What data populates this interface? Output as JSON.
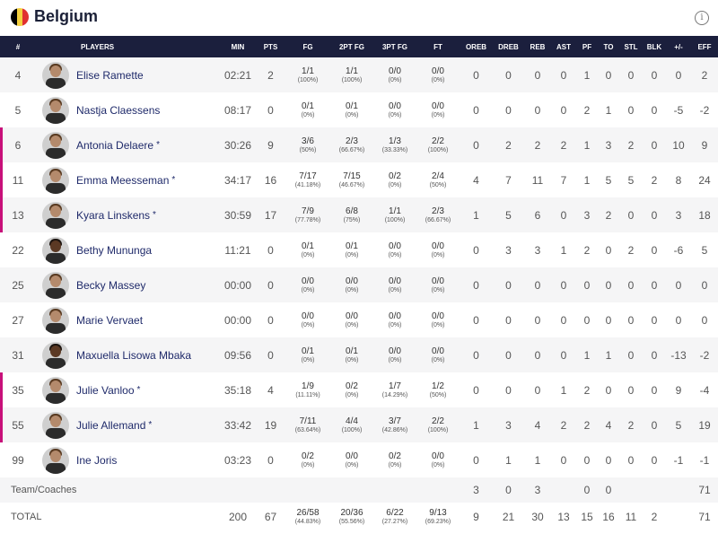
{
  "team": {
    "name": "Belgium",
    "flag_colors": [
      "#000000",
      "#f4d03f",
      "#e03030"
    ]
  },
  "info_icon": "info-icon",
  "columns": [
    "#",
    "PLAYERS",
    "MIN",
    "PTS",
    "FG",
    "2PT FG",
    "3PT FG",
    "FT",
    "OREB",
    "DREB",
    "REB",
    "AST",
    "PF",
    "TO",
    "STL",
    "BLK",
    "+/-",
    "EFF"
  ],
  "players": [
    {
      "no": "4",
      "name": "Elise Ramette",
      "starter": false,
      "min": "02:21",
      "pts": "2",
      "fg": "1/1",
      "fg_pct": "(100%)",
      "fg2": "1/1",
      "fg2_pct": "(100%)",
      "fg3": "0/0",
      "fg3_pct": "(0%)",
      "ft": "0/0",
      "ft_pct": "(0%)",
      "oreb": "0",
      "dreb": "0",
      "reb": "0",
      "ast": "0",
      "pf": "1",
      "to": "0",
      "stl": "0",
      "blk": "0",
      "pm": "0",
      "eff": "2"
    },
    {
      "no": "5",
      "name": "Nastja Claessens",
      "starter": false,
      "min": "08:17",
      "pts": "0",
      "fg": "0/1",
      "fg_pct": "(0%)",
      "fg2": "0/1",
      "fg2_pct": "(0%)",
      "fg3": "0/0",
      "fg3_pct": "(0%)",
      "ft": "0/0",
      "ft_pct": "(0%)",
      "oreb": "0",
      "dreb": "0",
      "reb": "0",
      "ast": "0",
      "pf": "2",
      "to": "1",
      "stl": "0",
      "blk": "0",
      "pm": "-5",
      "eff": "-2"
    },
    {
      "no": "6",
      "name": "Antonia Delaere",
      "starter": true,
      "min": "30:26",
      "pts": "9",
      "fg": "3/6",
      "fg_pct": "(50%)",
      "fg2": "2/3",
      "fg2_pct": "(66.67%)",
      "fg3": "1/3",
      "fg3_pct": "(33.33%)",
      "ft": "2/2",
      "ft_pct": "(100%)",
      "oreb": "0",
      "dreb": "2",
      "reb": "2",
      "ast": "2",
      "pf": "1",
      "to": "3",
      "stl": "2",
      "blk": "0",
      "pm": "10",
      "eff": "9"
    },
    {
      "no": "11",
      "name": "Emma Meesseman",
      "starter": true,
      "min": "34:17",
      "pts": "16",
      "fg": "7/17",
      "fg_pct": "(41.18%)",
      "fg2": "7/15",
      "fg2_pct": "(46.67%)",
      "fg3": "0/2",
      "fg3_pct": "(0%)",
      "ft": "2/4",
      "ft_pct": "(50%)",
      "oreb": "4",
      "dreb": "7",
      "reb": "11",
      "ast": "7",
      "pf": "1",
      "to": "5",
      "stl": "5",
      "blk": "2",
      "pm": "8",
      "eff": "24"
    },
    {
      "no": "13",
      "name": "Kyara Linskens",
      "starter": true,
      "min": "30:59",
      "pts": "17",
      "fg": "7/9",
      "fg_pct": "(77.78%)",
      "fg2": "6/8",
      "fg2_pct": "(75%)",
      "fg3": "1/1",
      "fg3_pct": "(100%)",
      "ft": "2/3",
      "ft_pct": "(66.67%)",
      "oreb": "1",
      "dreb": "5",
      "reb": "6",
      "ast": "0",
      "pf": "3",
      "to": "2",
      "stl": "0",
      "blk": "0",
      "pm": "3",
      "eff": "18"
    },
    {
      "no": "22",
      "name": "Bethy Mununga",
      "starter": false,
      "dark": true,
      "min": "11:21",
      "pts": "0",
      "fg": "0/1",
      "fg_pct": "(0%)",
      "fg2": "0/1",
      "fg2_pct": "(0%)",
      "fg3": "0/0",
      "fg3_pct": "(0%)",
      "ft": "0/0",
      "ft_pct": "(0%)",
      "oreb": "0",
      "dreb": "3",
      "reb": "3",
      "ast": "1",
      "pf": "2",
      "to": "0",
      "stl": "2",
      "blk": "0",
      "pm": "-6",
      "eff": "5"
    },
    {
      "no": "25",
      "name": "Becky Massey",
      "starter": false,
      "min": "00:00",
      "pts": "0",
      "fg": "0/0",
      "fg_pct": "(0%)",
      "fg2": "0/0",
      "fg2_pct": "(0%)",
      "fg3": "0/0",
      "fg3_pct": "(0%)",
      "ft": "0/0",
      "ft_pct": "(0%)",
      "oreb": "0",
      "dreb": "0",
      "reb": "0",
      "ast": "0",
      "pf": "0",
      "to": "0",
      "stl": "0",
      "blk": "0",
      "pm": "0",
      "eff": "0"
    },
    {
      "no": "27",
      "name": "Marie Vervaet",
      "starter": false,
      "min": "00:00",
      "pts": "0",
      "fg": "0/0",
      "fg_pct": "(0%)",
      "fg2": "0/0",
      "fg2_pct": "(0%)",
      "fg3": "0/0",
      "fg3_pct": "(0%)",
      "ft": "0/0",
      "ft_pct": "(0%)",
      "oreb": "0",
      "dreb": "0",
      "reb": "0",
      "ast": "0",
      "pf": "0",
      "to": "0",
      "stl": "0",
      "blk": "0",
      "pm": "0",
      "eff": "0"
    },
    {
      "no": "31",
      "name": "Maxuella Lisowa Mbaka",
      "starter": false,
      "dark": true,
      "min": "09:56",
      "pts": "0",
      "fg": "0/1",
      "fg_pct": "(0%)",
      "fg2": "0/1",
      "fg2_pct": "(0%)",
      "fg3": "0/0",
      "fg3_pct": "(0%)",
      "ft": "0/0",
      "ft_pct": "(0%)",
      "oreb": "0",
      "dreb": "0",
      "reb": "0",
      "ast": "0",
      "pf": "1",
      "to": "1",
      "stl": "0",
      "blk": "0",
      "pm": "-13",
      "eff": "-2"
    },
    {
      "no": "35",
      "name": "Julie Vanloo",
      "starter": true,
      "min": "35:18",
      "pts": "4",
      "fg": "1/9",
      "fg_pct": "(11.11%)",
      "fg2": "0/2",
      "fg2_pct": "(0%)",
      "fg3": "1/7",
      "fg3_pct": "(14.29%)",
      "ft": "1/2",
      "ft_pct": "(50%)",
      "oreb": "0",
      "dreb": "0",
      "reb": "0",
      "ast": "1",
      "pf": "2",
      "to": "0",
      "stl": "0",
      "blk": "0",
      "pm": "9",
      "eff": "-4"
    },
    {
      "no": "55",
      "name": "Julie Allemand",
      "starter": true,
      "min": "33:42",
      "pts": "19",
      "fg": "7/11",
      "fg_pct": "(63.64%)",
      "fg2": "4/4",
      "fg2_pct": "(100%)",
      "fg3": "3/7",
      "fg3_pct": "(42.86%)",
      "ft": "2/2",
      "ft_pct": "(100%)",
      "oreb": "1",
      "dreb": "3",
      "reb": "4",
      "ast": "2",
      "pf": "2",
      "to": "4",
      "stl": "2",
      "blk": "0",
      "pm": "5",
      "eff": "19"
    },
    {
      "no": "99",
      "name": "Ine Joris",
      "starter": false,
      "min": "03:23",
      "pts": "0",
      "fg": "0/2",
      "fg_pct": "(0%)",
      "fg2": "0/0",
      "fg2_pct": "(0%)",
      "fg3": "0/2",
      "fg3_pct": "(0%)",
      "ft": "0/0",
      "ft_pct": "(0%)",
      "oreb": "0",
      "dreb": "1",
      "reb": "1",
      "ast": "0",
      "pf": "0",
      "to": "0",
      "stl": "0",
      "blk": "0",
      "pm": "-1",
      "eff": "-1"
    }
  ],
  "team_row": {
    "label": "Team/Coaches",
    "oreb": "3",
    "dreb": "0",
    "reb": "3",
    "ast": "",
    "pf": "0",
    "to": "0",
    "stl": "",
    "blk": "",
    "pm": "",
    "eff": "71"
  },
  "total_row": {
    "label": "TOTAL",
    "min": "200",
    "pts": "67",
    "fg": "26/58",
    "fg_pct": "(44.83%)",
    "fg2": "20/36",
    "fg2_pct": "(55.56%)",
    "fg3": "6/22",
    "fg3_pct": "(27.27%)",
    "ft": "9/13",
    "ft_pct": "(69.23%)",
    "oreb": "9",
    "dreb": "21",
    "reb": "30",
    "ast": "13",
    "pf": "15",
    "to": "16",
    "stl": "11",
    "blk": "2",
    "pm": "",
    "eff": "71"
  },
  "accent_starter": "#c8107a",
  "header_bg": "#1b1f3d"
}
